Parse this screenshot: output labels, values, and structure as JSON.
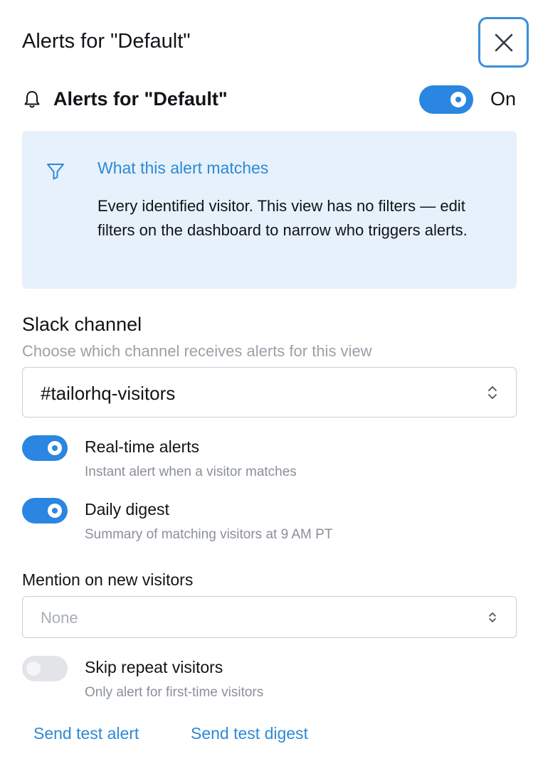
{
  "header": {
    "title": "Alerts for \"Default\"",
    "close_icon": "close-icon"
  },
  "alerts": {
    "title": "Alerts for \"Default\"",
    "icon": "bell-icon",
    "enabled": true,
    "state_label": "On"
  },
  "matches": {
    "icon": "filter-icon",
    "title": "What this alert matches",
    "body": "Every identified visitor. This view has no filters — edit filters on the dashboard to narrow who triggers alerts."
  },
  "slack": {
    "label": "Slack channel",
    "help": "Choose which channel receives alerts for this view",
    "selected": "#tailorhq-visitors"
  },
  "options": [
    {
      "title": "Real-time alerts",
      "description": "Instant alert when a visitor matches",
      "enabled": true
    },
    {
      "title": "Daily digest",
      "description": "Summary of matching visitors at 9 AM PT",
      "enabled": true
    }
  ],
  "mention": {
    "label": "Mention on new visitors",
    "placeholder": "None"
  },
  "skip_repeat": {
    "title": "Skip repeat visitors",
    "description": "Only alert for first-time visitors",
    "enabled": false
  },
  "actions": {
    "send_test_alert": "Send test alert",
    "send_test_digest": "Send test digest"
  },
  "colors": {
    "accent": "#2a86e0",
    "link": "#2e8ad6",
    "info_bg": "#e6f1fb",
    "focus_ring": "#3a8fd9"
  }
}
